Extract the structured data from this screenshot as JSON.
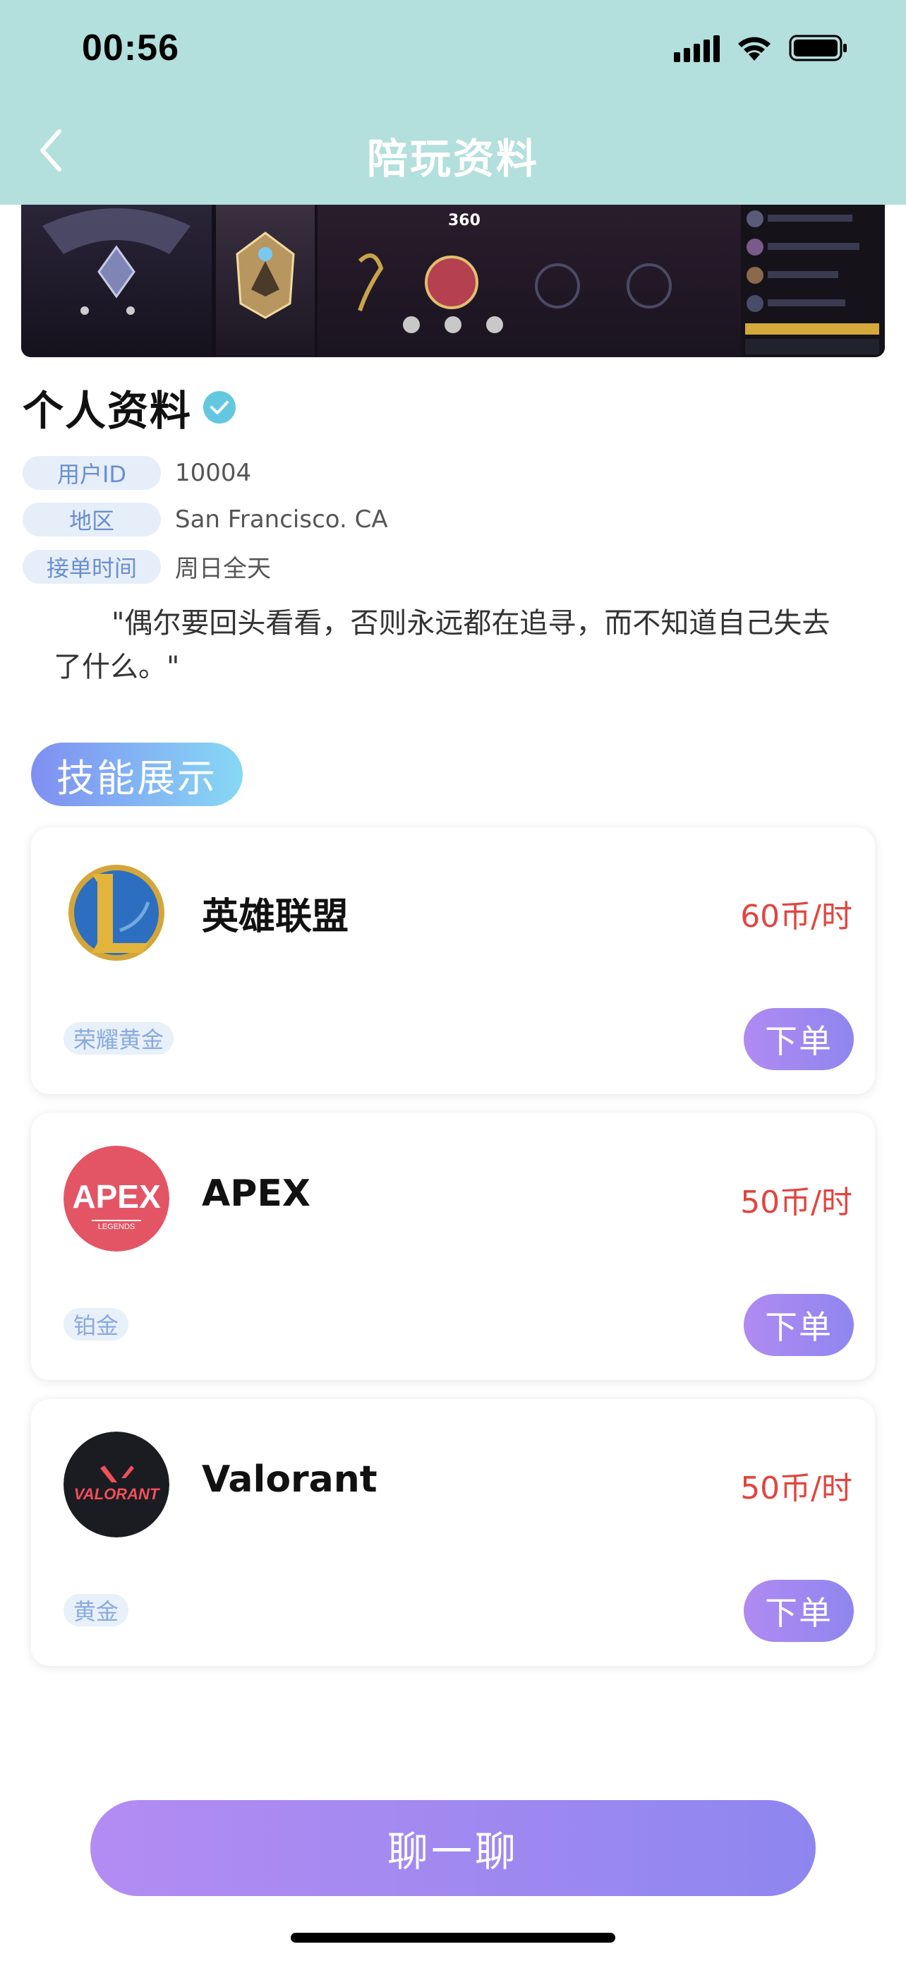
{
  "status_bar": {
    "time": "00:56"
  },
  "nav": {
    "title": "陪玩资料"
  },
  "banner": {
    "score": "360",
    "slide_count": 3
  },
  "profile": {
    "title": "个人资料",
    "rows": [
      {
        "tag": "用户ID",
        "value": "10004"
      },
      {
        "tag": "地区",
        "value": "San Francisco. CA"
      },
      {
        "tag": "接单时间",
        "value": "周日全天"
      }
    ],
    "bio": "\"偶尔要回头看看，否则永远都在追寻，而不知道自己失去了什么。\""
  },
  "skills": {
    "title": "技能展示",
    "cards": [
      {
        "name": "英雄联盟",
        "price": "60币/时",
        "rank": "荣耀黄金",
        "button": "下单",
        "logo": "league-of-legends-logo"
      },
      {
        "name": "APEX",
        "price": "50币/时",
        "rank": "铂金",
        "button": "下单",
        "logo": "apex-legends-logo",
        "logo_text": "APEX",
        "logo_subtext": "LEGENDS"
      },
      {
        "name": "Valorant",
        "price": "50币/时",
        "rank": "黄金",
        "button": "下单",
        "logo": "valorant-logo",
        "logo_text": "VALORANT"
      }
    ]
  },
  "chat_button": {
    "label": "聊一聊"
  },
  "colors": {
    "header": "#b3dfdc",
    "price": "#e2453f",
    "button_gradient_start": "#b38cf2",
    "button_gradient_end": "#8e86ef"
  }
}
